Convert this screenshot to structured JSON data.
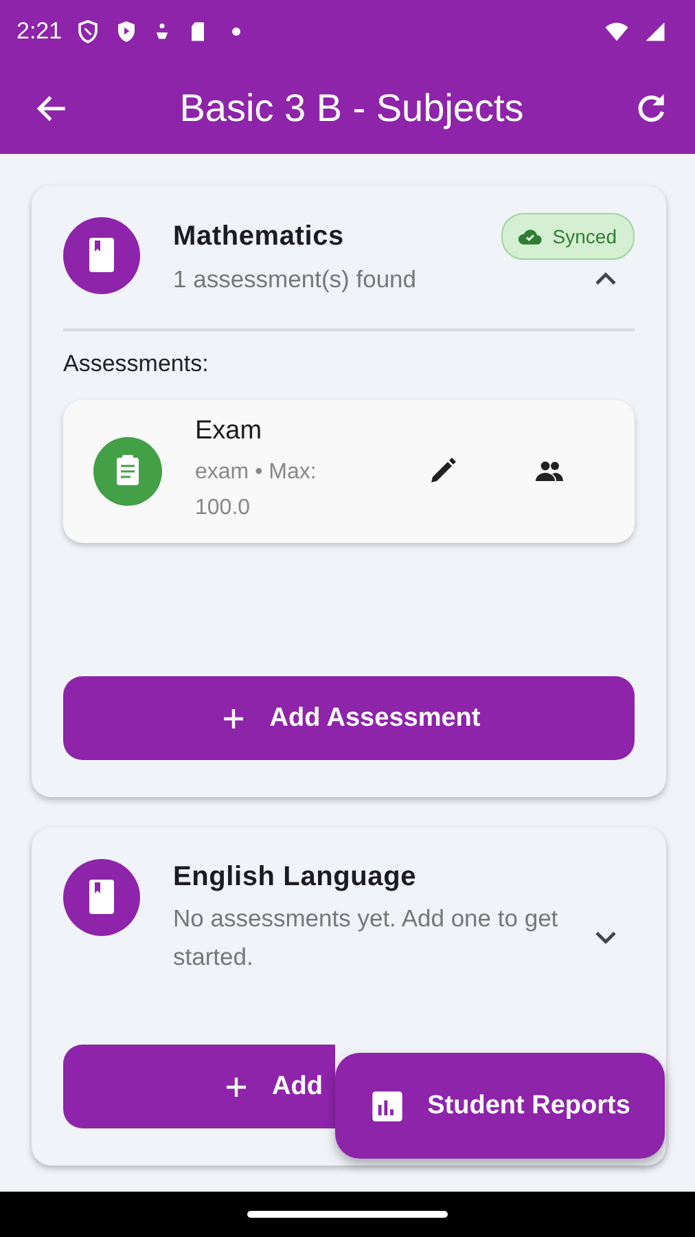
{
  "status_bar": {
    "time": "2:21"
  },
  "app_bar": {
    "title": "Basic 3 B - Subjects"
  },
  "subjects": [
    {
      "name": "Mathematics",
      "summary": "1 assessment(s) found",
      "expanded": true,
      "sync_badge": {
        "label": "Synced"
      },
      "section_label": "Assessments:",
      "assessments": [
        {
          "title": "Exam",
          "details": "exam • Max: 100.0"
        }
      ],
      "add_button": "Add Assessment"
    },
    {
      "name": "English Language",
      "summary": "No assessments yet. Add one to get started.",
      "expanded": false,
      "add_button": "Add"
    }
  ],
  "fab": {
    "label": "Student Reports"
  }
}
